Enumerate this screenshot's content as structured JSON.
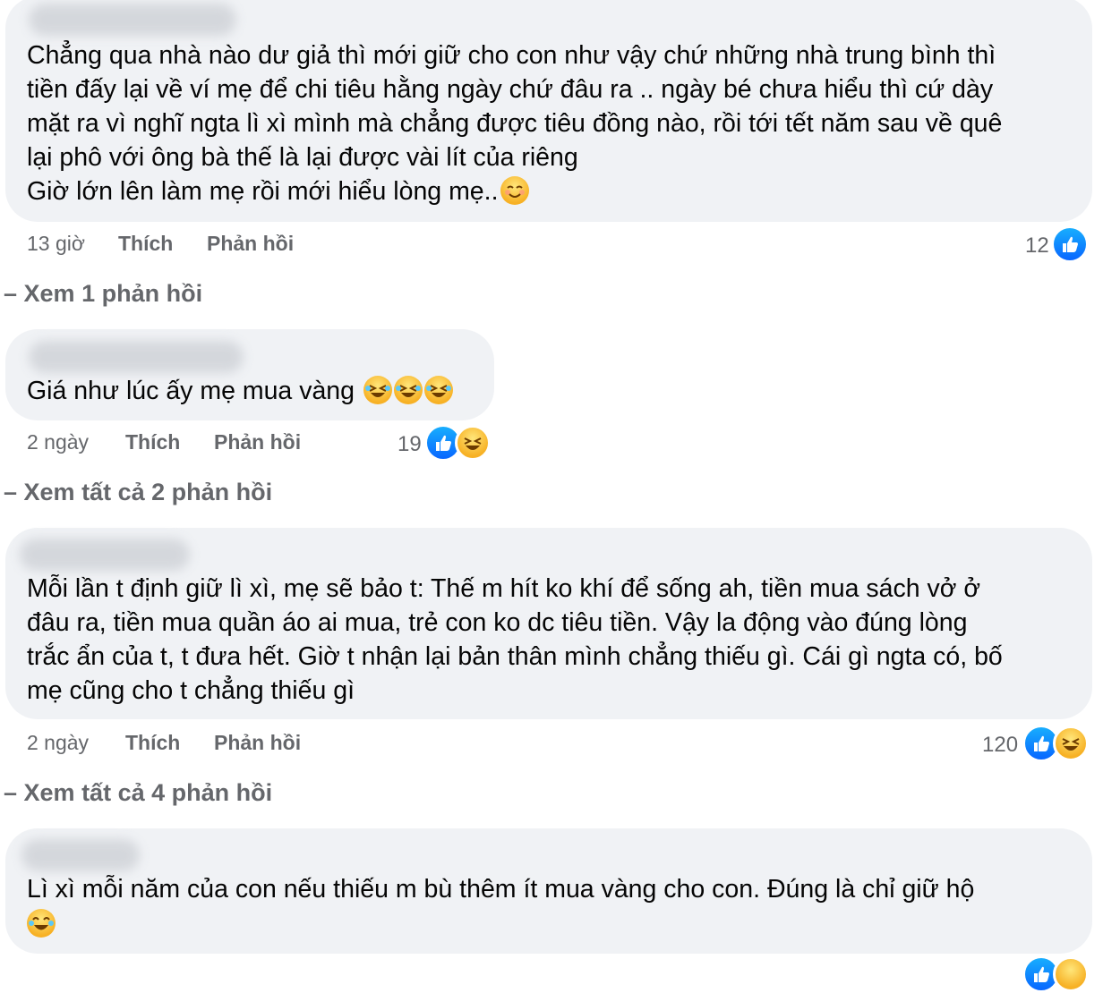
{
  "comments": [
    {
      "lines": [
        "Chẳng qua nhà nào dư giả thì mới giữ cho con như vậy chứ những nhà trung bình thì",
        "tiền đấy lại về ví mẹ để chi tiêu hằng ngày chứ đâu ra .. ngày bé chưa hiểu thì cứ dày",
        "mặt ra vì nghĩ ngta lì xì mình mà chẳng được tiêu đồng nào, rồi tới tết năm sau về quê",
        "lại phô với ông bà thế là lại được vài lít của riêng",
        "Giờ lớn lên làm mẹ rồi mới hiểu lòng mẹ.."
      ],
      "time": "13 giờ",
      "like_label": "Thích",
      "reply_label": "Phản hồi",
      "reaction_count": "12",
      "reactions": [
        "like-icon"
      ],
      "see_replies": "Xem 1 phản hồi"
    },
    {
      "lines": [
        "Giá như lúc ấy mẹ mua vàng"
      ],
      "time": "2 ngày",
      "like_label": "Thích",
      "reply_label": "Phản hồi",
      "reaction_count": "19",
      "reactions": [
        "like-icon",
        "haha-icon"
      ],
      "see_replies": "Xem tất cả 2 phản hồi"
    },
    {
      "lines": [
        "Mỗi lần t định giữ lì xì, mẹ sẽ bảo t: Thế m hít ko khí để sống ah, tiền mua sách vở ở",
        "đâu ra, tiền mua quần áo ai mua, trẻ con ko dc tiêu tiền. Vậy la động vào đúng lòng",
        "trắc ẩn của t, t đưa hết. Giờ t nhận lại bản thân mình chẳng thiếu gì. Cái gì ngta có, bố",
        "mẹ cũng cho t chẳng thiếu gì"
      ],
      "time": "2 ngày",
      "like_label": "Thích",
      "reply_label": "Phản hồi",
      "reaction_count": "120",
      "reactions": [
        "like-icon",
        "haha-icon"
      ],
      "see_replies": "Xem tất cả 4 phản hồi"
    },
    {
      "lines": [
        "Lì xì mỗi năm của con nếu thiếu m bù thêm ít mua vàng cho con. Đúng là chỉ giữ hộ"
      ]
    }
  ],
  "colors": {
    "bubble": "#f0f2f5",
    "meta_text": "#65676b",
    "like_blue": "#0866ff"
  }
}
